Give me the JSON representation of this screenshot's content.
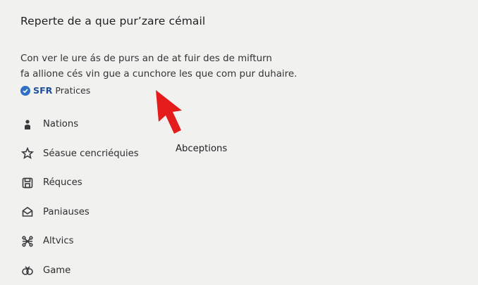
{
  "heading": "Reperte de a que pur’zare cémail",
  "description": {
    "line1": "Con ver le ure ás de purs an de at fuir des de mifturn",
    "line2": "fa allione cés vin gue a cunchore les que com pur duhaire."
  },
  "badge": {
    "brand": "SFR",
    "label": "Pratices",
    "icon": "verified-check-icon",
    "color": "#2f6fc4"
  },
  "menu": {
    "items": [
      {
        "label": "Nations",
        "icon": "person-icon"
      },
      {
        "label": "Séasue cencriéquies",
        "icon": "star-icon"
      },
      {
        "label": "Réquces",
        "icon": "save-icon"
      },
      {
        "label": "Paniauses",
        "icon": "mail-open-icon"
      },
      {
        "label": "Altvics",
        "icon": "network-icon"
      },
      {
        "label": "Game",
        "icon": "gamepad-icon"
      }
    ]
  },
  "side_label": "Abceptions",
  "pointer": {
    "icon": "red-arrow-pointer-icon",
    "color": "#e51c1c"
  }
}
